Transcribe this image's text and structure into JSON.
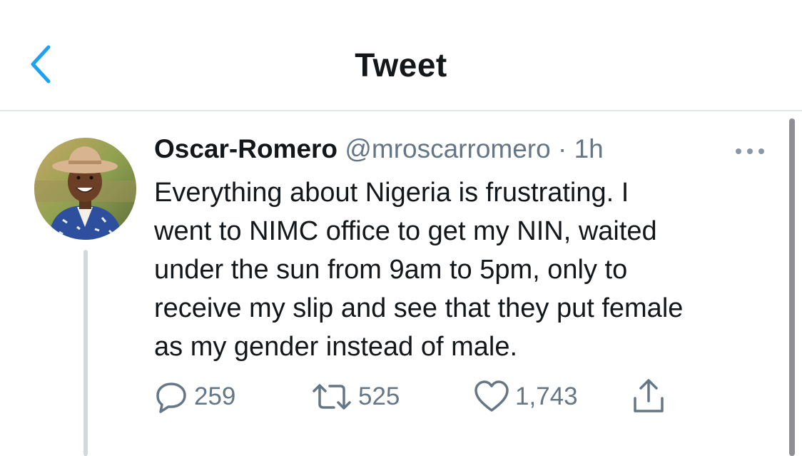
{
  "header": {
    "title": "Tweet",
    "back_icon": "chevron-left-icon",
    "accent": "#1da1f2"
  },
  "tweet": {
    "display_name": "Oscar-Romero",
    "handle": "@mroscarromero",
    "separator": "·",
    "time": "1h",
    "more_icon": "ellipsis-icon",
    "text_lines": [
      "Everything about Nigeria is frustrating. I",
      "went to NIMC office to get my NIN, waited",
      "under the sun from 9am to 5pm, only to",
      "receive my slip and see that they put female",
      "as my gender instead of male."
    ],
    "actions": {
      "reply": {
        "icon": "reply-icon",
        "count": "259"
      },
      "retweet": {
        "icon": "retweet-icon",
        "count": "525"
      },
      "like": {
        "icon": "heart-icon",
        "count": "1,743"
      },
      "share": {
        "icon": "share-icon",
        "count": ""
      }
    }
  },
  "colors": {
    "text_primary": "#14171a",
    "text_secondary": "#657786",
    "divider": "#e1e8ed",
    "thread_line": "#cfd9de"
  }
}
